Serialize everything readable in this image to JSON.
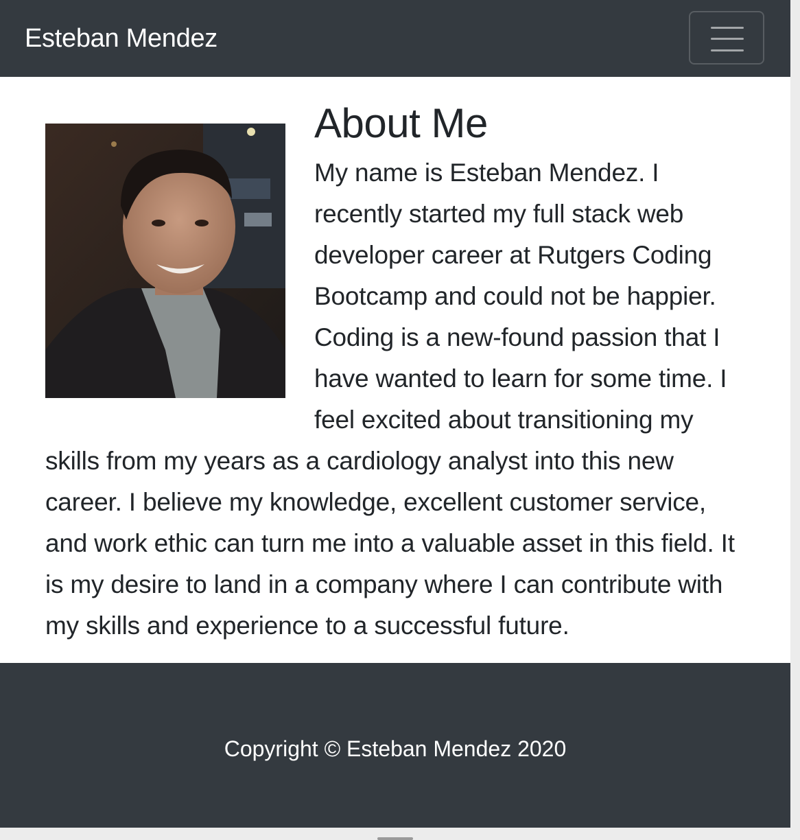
{
  "navbar": {
    "brand": "Esteban Mendez",
    "toggle_icon": "hamburger-menu-icon"
  },
  "about": {
    "heading": "About Me",
    "photo_alt": "Esteban Mendez",
    "bio": "My name is Esteban Mendez. I recently started my full stack web developer career at Rutgers Coding Bootcamp and could not be happier. Coding is a new-found passion that I have wanted to learn for some time. I feel excited about transitioning my skills from my years as a cardiology analyst into this new career. I believe my knowledge, excellent customer service, and work ethic can turn me into a valuable asset in this field. It is my desire to land in a company where I can contribute with my skills and experience to a successful future."
  },
  "footer": {
    "copyright": "Copyright © Esteban Mendez 2020"
  },
  "colors": {
    "navbar_bg": "#343a40",
    "footer_bg": "#343a40",
    "text": "#212529",
    "page_bg": "#ffffff"
  }
}
